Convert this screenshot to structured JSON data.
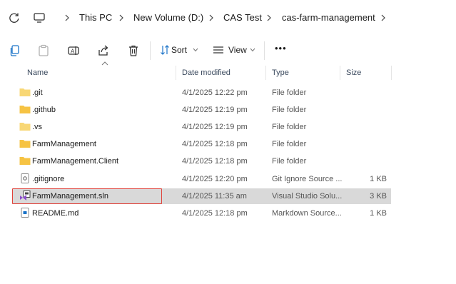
{
  "breadcrumb": [
    "This PC",
    "New Volume (D:)",
    "CAS Test",
    "cas-farm-management"
  ],
  "commands": {
    "sort_label": "Sort",
    "view_label": "View",
    "more_label": "•••"
  },
  "columns": {
    "name": "Name",
    "date": "Date modified",
    "type": "Type",
    "size": "Size"
  },
  "files": [
    {
      "name": ".git",
      "date": "4/1/2025 12:22 pm",
      "type": "File folder",
      "size": "",
      "icon": "folder-light-icon"
    },
    {
      "name": ".github",
      "date": "4/1/2025 12:19 pm",
      "type": "File folder",
      "size": "",
      "icon": "folder-icon"
    },
    {
      "name": ".vs",
      "date": "4/1/2025 12:19 pm",
      "type": "File folder",
      "size": "",
      "icon": "folder-light-icon"
    },
    {
      "name": "FarmManagement",
      "date": "4/1/2025 12:18 pm",
      "type": "File folder",
      "size": "",
      "icon": "folder-icon"
    },
    {
      "name": "FarmManagement.Client",
      "date": "4/1/2025 12:18 pm",
      "type": "File folder",
      "size": "",
      "icon": "folder-icon"
    },
    {
      "name": ".gitignore",
      "date": "4/1/2025 12:20 pm",
      "type": "Git Ignore Source ...",
      "size": "1 KB",
      "icon": "text-file-icon"
    },
    {
      "name": "FarmManagement.sln",
      "date": "4/1/2025 11:35 am",
      "type": "Visual Studio Solu...",
      "size": "3 KB",
      "icon": "visual-studio-solution-icon"
    },
    {
      "name": "README.md",
      "date": "4/1/2025 12:18 pm",
      "type": "Markdown Source...",
      "size": "1 KB",
      "icon": "markdown-file-icon"
    }
  ],
  "colors": {
    "folder": "#f6c343",
    "folder_light": "#f8d775",
    "selection": "#d9d9d9",
    "highlight_border": "#e0423a",
    "accent": "#1a73c8"
  }
}
